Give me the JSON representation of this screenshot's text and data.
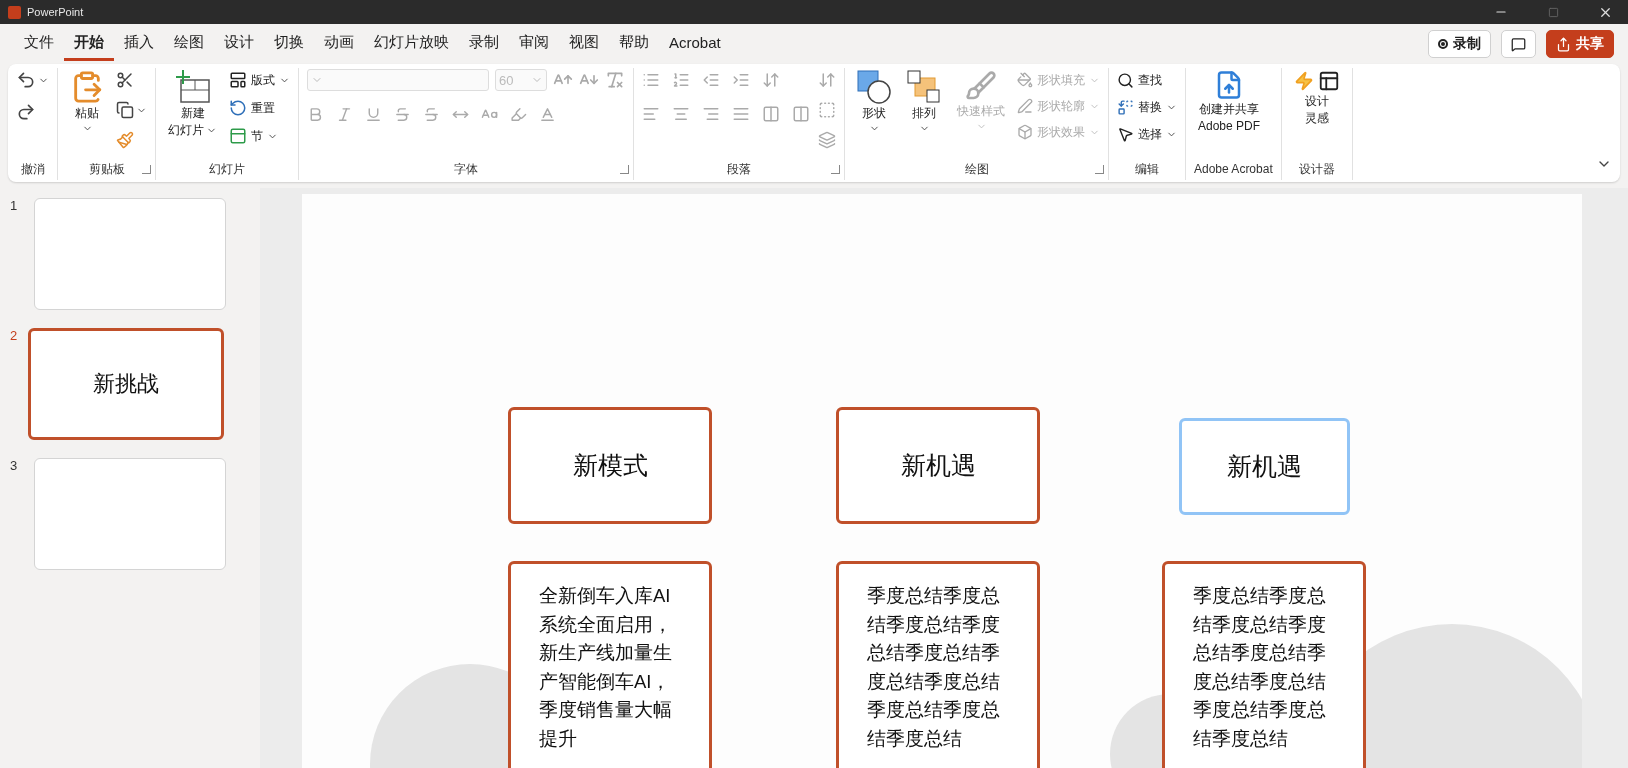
{
  "window": {
    "app_name": "PowerPoint"
  },
  "menu_tabs": [
    {
      "label": "文件",
      "selected": false
    },
    {
      "label": "开始",
      "selected": true
    },
    {
      "label": "插入",
      "selected": false
    },
    {
      "label": "绘图",
      "selected": false
    },
    {
      "label": "设计",
      "selected": false
    },
    {
      "label": "切换",
      "selected": false
    },
    {
      "label": "动画",
      "selected": false
    },
    {
      "label": "幻灯片放映",
      "selected": false
    },
    {
      "label": "录制",
      "selected": false
    },
    {
      "label": "审阅",
      "selected": false
    },
    {
      "label": "视图",
      "selected": false
    },
    {
      "label": "帮助",
      "selected": false
    },
    {
      "label": "Acrobat",
      "selected": false
    }
  ],
  "top_buttons": [
    {
      "kind": "record",
      "label": "录制"
    },
    {
      "kind": "comments"
    },
    {
      "kind": "share",
      "label": "共享"
    }
  ],
  "ribbon": {
    "groups": [
      {
        "kind": "undo",
        "label": "撤消",
        "launcher": false
      },
      {
        "kind": "clipboard",
        "label": "剪贴板",
        "launcher": true,
        "paste_label": "粘贴"
      },
      {
        "kind": "slides",
        "label": "幻灯片",
        "launcher": false,
        "new_slide_lines": [
          "新建",
          "幻灯片"
        ],
        "items": [
          {
            "label": "版式",
            "dropdown": true
          },
          {
            "label": "重置",
            "dropdown": false
          },
          {
            "label": "节",
            "dropdown": true
          }
        ]
      },
      {
        "kind": "font",
        "label": "字体",
        "launcher": true,
        "disabled": true,
        "font_size": "60"
      },
      {
        "kind": "paragraph",
        "label": "段落",
        "launcher": true,
        "disabled": true
      },
      {
        "kind": "drawing",
        "label": "绘图",
        "launcher": true,
        "shape_label": "形状",
        "arrange_label": "排列",
        "quick_styles": {
          "label": "快速样式",
          "disabled": true
        },
        "items": [
          {
            "label": "形状填充",
            "disabled": true
          },
          {
            "label": "形状轮廓",
            "disabled": true
          },
          {
            "label": "形状效果",
            "disabled": true
          }
        ]
      },
      {
        "kind": "editing",
        "label": "编辑",
        "launcher": false,
        "items": [
          {
            "label": "查找",
            "dropdown": false
          },
          {
            "label": "替换",
            "dropdown": true
          },
          {
            "label": "选择",
            "dropdown": true
          }
        ]
      },
      {
        "kind": "acrobat",
        "label": "Adobe Acrobat",
        "launcher": false,
        "button_lines": [
          "创建并共享",
          "Adobe PDF"
        ]
      },
      {
        "kind": "designer",
        "label": "设计器",
        "launcher": false,
        "button_lines": [
          "设计",
          "灵感"
        ]
      }
    ]
  },
  "slide_thumbnails": [
    {
      "number": "1",
      "selected": false
    },
    {
      "number": "2",
      "selected": true,
      "title": "新挑战"
    },
    {
      "number": "3",
      "selected": false
    }
  ],
  "slide": {
    "columns": [
      {
        "title": {
          "text": "新模式",
          "selected": false
        },
        "body": "全新倒车入库AI系统全面启用，新生产线加量生产智能倒车AI，季度销售量大幅提升"
      },
      {
        "title": {
          "text": "新机遇",
          "selected": false
        },
        "body": "季度总结季度总结季度总结季度总结季度总结季度总结季度总结季度总结季度总结季度总结"
      },
      {
        "title": {
          "text": "新机遇",
          "selected": true
        },
        "body": "季度总结季度总结季度总结季度总结季度总结季度总结季度总结季度总结季度总结季度总结"
      }
    ]
  }
}
